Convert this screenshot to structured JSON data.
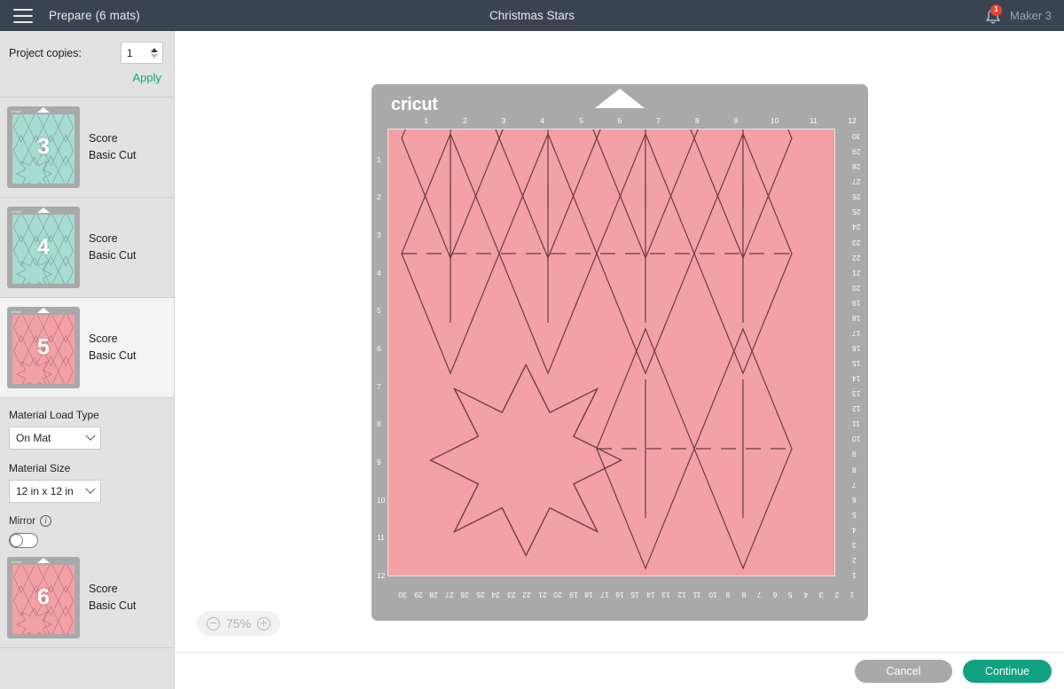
{
  "header": {
    "menu_icon": "hamburger-icon",
    "prepare_label": "Prepare (6 mats)",
    "project_title": "Christmas Stars",
    "bell_icon": "bell-icon",
    "notification_count": "1",
    "machine_name": "Maker 3"
  },
  "sidebar": {
    "copies_label": "Project copies:",
    "copies_value": "1",
    "apply_label": "Apply",
    "mats": [
      {
        "number": "3",
        "ops": [
          "Score",
          "Basic Cut"
        ],
        "color": "#a6dcd2",
        "active": false,
        "shapes": "diamonds-star"
      },
      {
        "number": "4",
        "ops": [
          "Score",
          "Basic Cut"
        ],
        "color": "#a6dcd2",
        "active": false,
        "shapes": "diamonds-star"
      },
      {
        "number": "5",
        "ops": [
          "Score",
          "Basic Cut"
        ],
        "color": "#f4a0a7",
        "active": true,
        "shapes": "diamonds-star"
      },
      {
        "number": "6",
        "ops": [
          "Score",
          "Basic Cut"
        ],
        "color": "#f4a0a7",
        "active": false,
        "shapes": "diamonds-star"
      }
    ],
    "material_load_type": {
      "label": "Material Load Type",
      "value": "On Mat"
    },
    "material_size": {
      "label": "Material Size",
      "value": "12 in x 12 in"
    },
    "mirror": {
      "label": "Mirror",
      "info_icon": "info-icon",
      "enabled": false
    }
  },
  "canvas": {
    "brand": "cricut",
    "mat_color": "#f4a0a7",
    "board_color": "#a9a9a9",
    "ruler_top": [
      "1",
      "2",
      "3",
      "4",
      "5",
      "6",
      "7",
      "8",
      "9",
      "10",
      "11",
      "12"
    ],
    "ruler_left": [
      "1",
      "2",
      "3",
      "4",
      "5",
      "6",
      "7",
      "8",
      "9",
      "10",
      "11",
      "12"
    ],
    "ruler_bottom": [
      "30",
      "29",
      "28",
      "27",
      "26",
      "25",
      "24",
      "23",
      "22",
      "21",
      "20",
      "19",
      "18",
      "17",
      "16",
      "15",
      "14",
      "13",
      "12",
      "11",
      "10",
      "9",
      "8",
      "7",
      "6",
      "5",
      "4",
      "3",
      "2",
      "1"
    ],
    "ruler_right": [
      "30",
      "29",
      "28",
      "27",
      "26",
      "25",
      "24",
      "23",
      "22",
      "21",
      "20",
      "19",
      "18",
      "17",
      "16",
      "15",
      "14",
      "13",
      "12",
      "11",
      "10",
      "9",
      "8",
      "7",
      "6",
      "5",
      "4",
      "3",
      "2",
      "1"
    ],
    "zoom": {
      "minus_icon": "zoom-out-icon",
      "level": "75%",
      "plus_icon": "zoom-in-icon"
    }
  },
  "footer": {
    "cancel_label": "Cancel",
    "continue_label": "Continue",
    "cancel_color": "#a9a9a9",
    "continue_color": "#10a37f"
  }
}
